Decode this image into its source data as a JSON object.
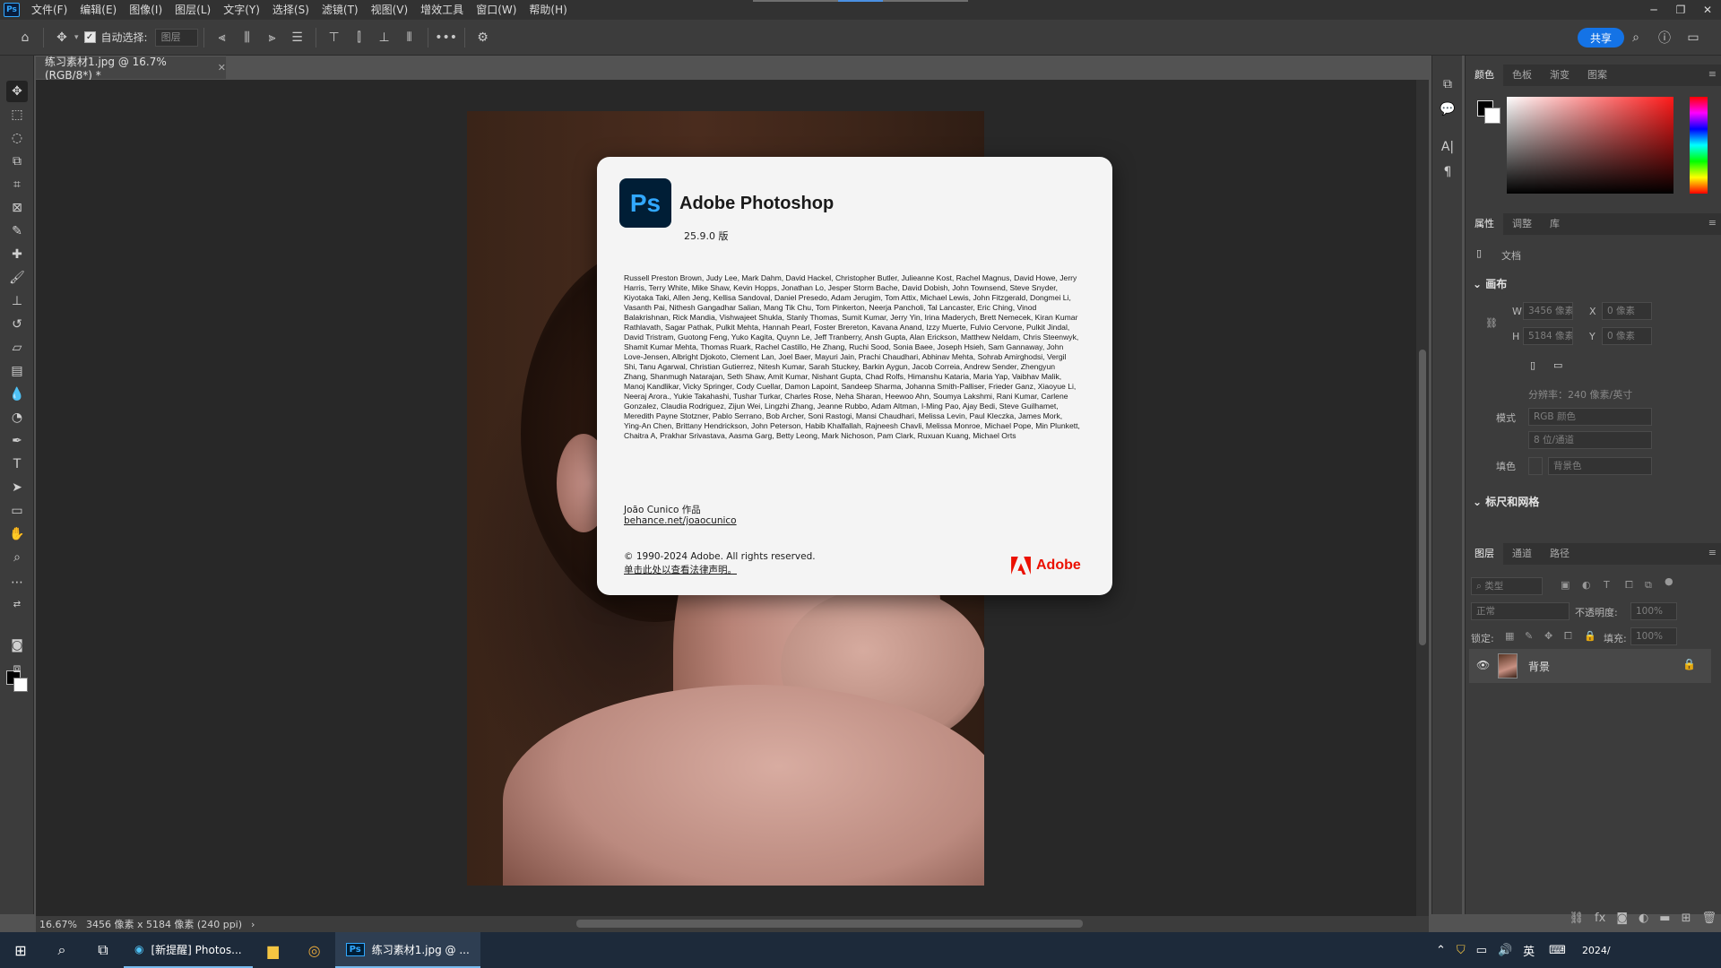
{
  "menubar": {
    "app_badge": "Ps",
    "items": [
      "文件(F)",
      "编辑(E)",
      "图像(I)",
      "图层(L)",
      "文字(Y)",
      "选择(S)",
      "滤镜(T)",
      "视图(V)",
      "增效工具",
      "窗口(W)",
      "帮助(H)"
    ]
  },
  "options": {
    "autoselect_label": "自动选择:",
    "layer_select_value": "图层",
    "share_label": "共享"
  },
  "document": {
    "tab_title": "练习素材1.jpg @ 16.7%(RGB/8*) *",
    "status_zoom": "16.67%",
    "status_info": "3456 像素 x 5184 像素 (240 ppi)"
  },
  "about": {
    "badge": "Ps",
    "title": "Adobe Photoshop",
    "version": "25.9.0 版",
    "credits": "Russell Preston Brown, Judy Lee, Mark Dahm, David Hackel, Christopher Butler, Julieanne Kost, Rachel Magnus, David Howe, Jerry Harris, Terry White, Mike Shaw, Kevin Hopps, Jonathan Lo, Jesper Storm Bache, David Dobish, John Townsend, Steve Snyder, Kiyotaka Taki, Allen Jeng, Kellisa Sandoval, Daniel Presedo, Adam Jerugim, Tom Attix, Michael Lewis, John Fitzgerald, Dongmei Li, Vasanth Pai, Nithesh Gangadhar Salian, Mang Tik Chu, Tom Pinkerton, Neerja Pancholi, Tal Lancaster, Eric Ching, Vinod Balakrishnan, Rick Mandia, Vishwajeet Shukla, Stanly Thomas, Sumit Kumar, Jerry Yin, Irina Maderych, Brett Nemecek, Kiran Kumar Rathlavath, Sagar Pathak, Pulkit Mehta, Hannah Pearl, Foster Brereton, Kavana Anand, Izzy Muerte, Fulvio Cervone, Pulkit Jindal, David Tristram, Guotong Feng, Yuko Kagita, Quynn Le, Jeff Tranberry, Ansh Gupta, Alan Erickson, Matthew Neldam, Chris Steenwyk, Shamit Kumar Mehta, Thomas Ruark, Rachel Castillo, He Zhang, Ruchi Sood, Sonia Baee, Joseph Hsieh, Sam Gannaway, John Love-Jensen, Albright Djokoto, Clement Lan, Joel Baer, Mayuri Jain, Prachi Chaudhari, Abhinav Mehta, Sohrab Amirghodsi, Vergil Shi, Tanu Agarwal, Christian Gutierrez, Nitesh Kumar, Sarah Stuckey, Barkin Aygun, Jacob Correia, Andrew Sender, Zhengyun Zhang, Shanmugh Natarajan, Seth Shaw, Amit Kumar, Nishant Gupta, Chad Rolfs, Himanshu Kataria, Maria Yap, Vaibhav Malik, Manoj Kandlikar, Vicky Springer, Cody Cuellar, Damon Lapoint, Sandeep Sharma, Johanna Smith-Palliser, Frieder Ganz, Xiaoyue Li, Neeraj Arora., Yukie Takahashi, Tushar Turkar, Charles Rose, Neha Sharan, Heewoo Ahn, Soumya Lakshmi, Rani Kumar, Carlene Gonzalez, Claudia Rodriguez, Zijun Wei, Lingzhi Zhang, Jeanne Rubbo, Adam Altman, I-Ming Pao, Ajay Bedi, Steve Guilhamet, Meredith Payne Stotzner, Pablo Serrano, Bob Archer, Soni Rastogi, Mansi Chaudhari, Melissa Levin, Paul Kleczka, James Mork, Ying-An Chen, Brittany Hendrickson, John Peterson, Habib Khalfallah, Rajneesh Chavli, Melissa Monroe, Michael Pope, Min Plunkett, Chaitra A, Prakhar Srivastava, Aasma Garg, Betty Leong, Mark Nichoson, Pam Clark, Ruxuan Kuang, Michael Orts",
    "artwork_credit": "João Cunico 作品",
    "artwork_link": "behance.net/joaocunico",
    "copyright": "© 1990-2024 Adobe. All rights reserved.",
    "legal_link": "单击此处以查看法律声明。",
    "adobe_wordmark": "Adobe"
  },
  "panels": {
    "color_tabs": [
      "颜色",
      "色板",
      "渐变",
      "图案"
    ],
    "properties_tabs": [
      "属性",
      "调整",
      "库"
    ],
    "doc_label": "文档",
    "canvas_section": "画布",
    "w_label": "W",
    "w_value": "3456 像素",
    "h_label": "H",
    "h_value": "5184 像素",
    "x_label": "X",
    "x_value": "0 像素",
    "y_label": "Y",
    "y_value": "0 像素",
    "resolution": "分辨率：240 像素/英寸",
    "mode_label": "模式",
    "mode_value": "RGB 颜色",
    "depth_value": "8 位/通道",
    "fill_label": "填色",
    "fill_value": "背景色",
    "rulers_section": "标尺和网格",
    "layers_tabs": [
      "图层",
      "通道",
      "路径"
    ],
    "layer_filter": "类型",
    "blend_mode": "正常",
    "opacity_label": "不透明度:",
    "opacity_value": "100%",
    "lock_label": "锁定:",
    "fill2_label": "填充:",
    "fill2_value": "100%",
    "layer_name": "背景"
  },
  "taskbar": {
    "app1": "[新提醒] Photos...",
    "app2": "练习素材1.jpg @ ...",
    "ime": "英",
    "date": "2024/"
  }
}
